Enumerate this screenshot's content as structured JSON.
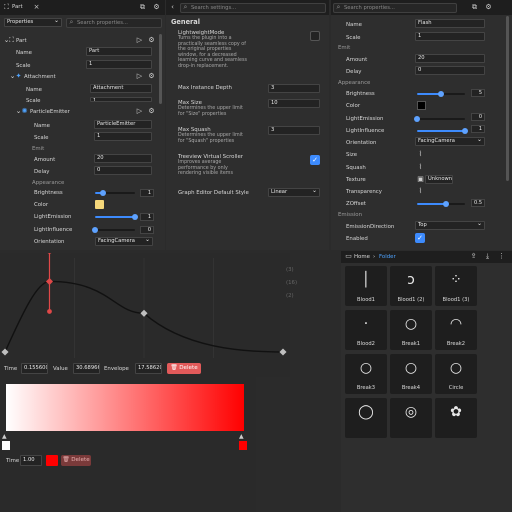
{
  "explorer": {
    "tab": "Part",
    "filter": "Properties",
    "search": "Search properties...",
    "tree_root": "Part",
    "props": [
      {
        "label": "Name",
        "value": "Part"
      },
      {
        "label": "Scale",
        "value": "1"
      }
    ],
    "attachment": {
      "label": "Attachment",
      "props": [
        {
          "label": "Name",
          "value": "Attachment"
        },
        {
          "label": "Scale",
          "value": "1"
        }
      ]
    },
    "emitter": {
      "label": "ParticleEmitter",
      "props": [
        {
          "label": "Name",
          "value": "ParticleEmitter"
        },
        {
          "label": "Scale",
          "value": "1"
        }
      ],
      "emit_section": "Emit",
      "emit": [
        {
          "label": "Amount",
          "value": "20"
        },
        {
          "label": "Delay",
          "value": "0"
        }
      ],
      "appearance_section": "Appearance",
      "brightness": {
        "label": "Brightness",
        "value": "1",
        "level": 0.2
      },
      "color": {
        "label": "Color",
        "hex": "#f5d77a"
      },
      "lightemission": {
        "label": "LightEmission",
        "value": "1",
        "level": 1.0
      },
      "lightinfluence": {
        "label": "LightInfluence",
        "value": "0",
        "level": 0.0
      },
      "orientation": {
        "label": "Orientation",
        "value": "FacingCamera"
      }
    }
  },
  "settings": {
    "search": "Search settings...",
    "section": "General",
    "items": [
      {
        "title": "LightweightMode",
        "desc": [
          "Turns the plugin into a",
          "practically seamless copy of",
          "the original properties",
          "window, for a decreased",
          "learning curve and seamless",
          "drop-in replacement."
        ],
        "type": "checkbox",
        "checked": false
      },
      {
        "title": "Max Instance Depth",
        "desc": [],
        "type": "number",
        "value": "3"
      },
      {
        "title": "Max Size",
        "desc": [
          "Determines the upper limit",
          "for \"Size\" properties"
        ],
        "type": "number",
        "value": "10"
      },
      {
        "title": "Max Squash",
        "desc": [
          "Determines the upper limit",
          "for \"Squash\" properties"
        ],
        "type": "number",
        "value": "3"
      },
      {
        "title": "Treeview Virtual Scroller",
        "desc": [
          "Improves average",
          "performance by only",
          "rendering visible items"
        ],
        "type": "checkbox",
        "checked": true
      },
      {
        "title": "Graph Editor Default Style",
        "desc": [],
        "type": "select",
        "value": "Linear"
      }
    ]
  },
  "props": {
    "search": "Search properties...",
    "basic": [
      {
        "label": "Name",
        "value": "Flash"
      },
      {
        "label": "Scale",
        "value": "1"
      }
    ],
    "emit_section": "Emit",
    "emit": [
      {
        "label": "Amount",
        "value": "20"
      },
      {
        "label": "Delay",
        "value": "0"
      }
    ],
    "appearance_section": "Appearance",
    "brightness": {
      "label": "Brightness",
      "value": "5",
      "level": 0.5
    },
    "color": {
      "label": "Color",
      "hex": "#000000"
    },
    "lightemission": {
      "label": "LightEmission",
      "value": "0",
      "level": 0.0
    },
    "lightinfluence": {
      "label": "LightInfluence",
      "value": "1",
      "level": 1.0
    },
    "orientation": {
      "label": "Orientation",
      "value": "FacingCamera"
    },
    "size": {
      "label": "Size"
    },
    "squash": {
      "label": "Squash"
    },
    "texture": {
      "label": "Texture",
      "value": "Unknown"
    },
    "transparency": {
      "label": "Transparency"
    },
    "zoffset": {
      "label": "ZOffset",
      "value": "0.5",
      "level": 0.6
    },
    "emission_section": "Emission",
    "emissiondirection": {
      "label": "EmissionDirection",
      "value": "Top"
    },
    "enabled": {
      "label": "Enabled",
      "checked": true
    }
  },
  "assets": {
    "breadcrumb_home": "Home",
    "breadcrumb_folder": "Folder",
    "items": [
      "Blood1",
      "Blood1 (2)",
      "Blood1 (3)",
      "Blood2",
      "Break1",
      "Break2",
      "Break3",
      "Break4",
      "Circle",
      "",
      "",
      ""
    ]
  },
  "graph": {
    "time_label": "Time",
    "time_value": "0.155600",
    "value_label": "Value",
    "value_value": "30.68966",
    "env_label": "Envelope",
    "env_value": "17.58620",
    "delete_label": "Delete",
    "ghost_items": [
      "(3)",
      "(16)",
      "(2)"
    ],
    "curve": [
      {
        "t": 0,
        "v": 0.0
      },
      {
        "t": 0.16,
        "v": 0.82
      },
      {
        "t": 0.5,
        "v": 0.45
      },
      {
        "t": 1,
        "v": 0.0
      }
    ]
  },
  "gradient": {
    "start_hex": "#ffffff",
    "end_hex": "#ff0000",
    "time_label": "Time",
    "time_value": "1.00",
    "color_hex": "#ff0000",
    "delete_label": "Delete"
  }
}
